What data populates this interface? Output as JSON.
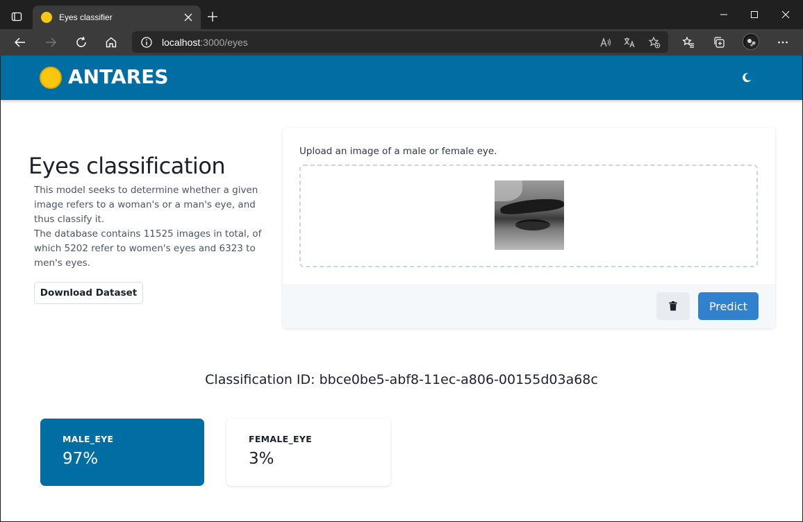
{
  "browser": {
    "tab_title": "Eyes classifier",
    "url_host": "localhost",
    "url_path": ":3000/eyes"
  },
  "header": {
    "brand": "ANTARES"
  },
  "intro": {
    "title": "Eyes classification",
    "description_1": "This model seeks to determine whether a given image refers to a woman's or a man's eye, and thus classify it.",
    "description_2": "The database contains 11525 images in total, of which 5202 refer to women's eyes and 6323 to men's eyes.",
    "download_label": "Download Dataset"
  },
  "upload": {
    "label": "Upload an image of a male or female eye.",
    "predict_label": "Predict"
  },
  "result": {
    "classification_id_label": "Classification ID: bbce0be5-abf8-11ec-a806-00155d03a68c",
    "classes": [
      {
        "name": "MALE_EYE",
        "value": "97%"
      },
      {
        "name": "FEMALE_EYE",
        "value": "3%"
      }
    ]
  },
  "colors": {
    "brand_primary": "#006da3",
    "accent_yellow": "#f9c80e",
    "predict_button": "#3182ce"
  }
}
